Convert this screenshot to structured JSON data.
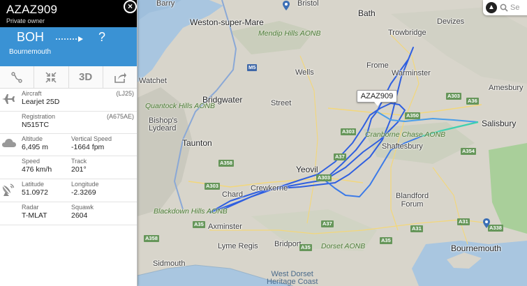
{
  "flight": {
    "callsign": "AZAZ909",
    "owner": "Private owner",
    "close_symbol": "×",
    "origin": "BOH",
    "destination": "?",
    "origin_city": "Bournemouth"
  },
  "toolbar": {
    "route_icon": "route-icon",
    "expand_icon": "collapse-expand-icon",
    "view3d_label": "3D",
    "share_icon": "share-icon"
  },
  "details": {
    "aircraft_label": "Aircraft",
    "aircraft_code": "(LJ25)",
    "aircraft_value": "Learjet 25D",
    "registration_label": "Registration",
    "registration_code": "(A675AE)",
    "registration_value": "N515TC",
    "altitude_label": "Altitude",
    "altitude_value": "6,495 m",
    "vspeed_label": "Vertical Speed",
    "vspeed_value": "-1664 fpm",
    "speed_label": "Speed",
    "speed_value": "476 km/h",
    "track_label": "Track",
    "track_value": "201°",
    "latitude_label": "Latitude",
    "latitude_value": "51.0972",
    "longitude_label": "Longitude",
    "longitude_value": "-2.3269",
    "radar_label": "Radar",
    "radar_value": "T-MLAT",
    "squawk_label": "Squawk",
    "squawk_value": "2604"
  },
  "map": {
    "search_placeholder": "Se",
    "aircraft_label": "AZAZ909",
    "places": {
      "barry": "Barry",
      "bristol": "Bristol",
      "weston": "Weston-super-Mare",
      "bath": "Bath",
      "devizes": "Devizes",
      "mendip": "Mendip Hills AONB",
      "trowbridge": "Trowbridge",
      "frome": "Frome",
      "wells": "Wells",
      "warminster": "Warminster",
      "amesbury": "Amesbury",
      "watchet": "Watchet",
      "bridgwater": "Bridgwater",
      "street": "Street",
      "quantock": "Quantock Hills AONB",
      "bishops": "Bishop's\nLydeard",
      "salisbury": "Salisbury",
      "cranborne": "Cranborne Chase AONB",
      "taunton": "Taunton",
      "shaftesbury": "Shaftesbury",
      "yeovil": "Yeovil",
      "chard": "Chard",
      "crewkerne": "Crewkerne",
      "blandford": "Blandford\nForum",
      "blackdown": "Blackdown Hills AONB",
      "axminster": "Axminster",
      "lymeregis": "Lyme Regis",
      "bridport": "Bridport",
      "dorset": "Dorset AONB",
      "bournemouth": "Bournemouth",
      "sidmouth": "Sidmouth",
      "westdorset": "West Dorset\nHeritage Coast"
    },
    "roads": [
      "M5",
      "A303",
      "A36",
      "A350",
      "A303",
      "A354",
      "A358",
      "A37",
      "A303",
      "A35",
      "A31",
      "A31",
      "A338",
      "A35",
      "A35",
      "A358",
      "A37",
      "A303"
    ],
    "colors": {
      "track_blue": "#2f5fe0",
      "track_light": "#4a9ee8",
      "track_teal": "#3fd0b0",
      "panel_route": "#3a92d4"
    }
  }
}
